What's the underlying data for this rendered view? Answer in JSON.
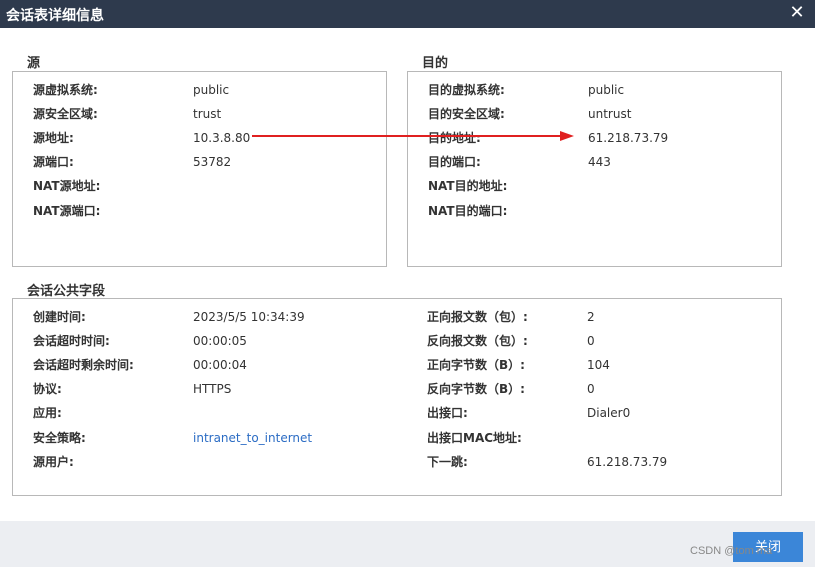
{
  "window": {
    "title": "会话表详细信息",
    "close_glyph": "✕"
  },
  "source": {
    "section_title": "源",
    "rows": [
      {
        "label": "源虚拟系统:",
        "value": "public"
      },
      {
        "label": "源安全区域:",
        "value": "trust"
      },
      {
        "label": "源地址:",
        "value": "10.3.8.80"
      },
      {
        "label": "源端口:",
        "value": "53782"
      },
      {
        "label": "NAT源地址:",
        "value": ""
      },
      {
        "label": "NAT源端口:",
        "value": ""
      }
    ]
  },
  "destination": {
    "section_title": "目的",
    "rows": [
      {
        "label": "目的虚拟系统:",
        "value": "public"
      },
      {
        "label": "目的安全区域:",
        "value": "untrust"
      },
      {
        "label": "目的地址:",
        "value": "61.218.73.79"
      },
      {
        "label": "目的端口:",
        "value": "443"
      },
      {
        "label": "NAT目的地址:",
        "value": ""
      },
      {
        "label": "NAT目的端口:",
        "value": ""
      }
    ]
  },
  "common": {
    "section_title": "会话公共字段",
    "left_rows": [
      {
        "label": "创建时间:",
        "value": "2023/5/5 10:34:39"
      },
      {
        "label": "会话超时时间:",
        "value": "00:00:05"
      },
      {
        "label": "会话超时剩余时间:",
        "value": "00:00:04"
      },
      {
        "label": "协议:",
        "value": "HTTPS"
      },
      {
        "label": "应用:",
        "value": ""
      },
      {
        "label": "安全策略:",
        "value": "intranet_to_internet"
      },
      {
        "label": "源用户:",
        "value": ""
      }
    ],
    "right_rows": [
      {
        "label": "正向报文数（包）:",
        "value": "2"
      },
      {
        "label": "反向报文数（包）:",
        "value": "0"
      },
      {
        "label": "正向字节数（B）:",
        "value": "104"
      },
      {
        "label": "反向字节数（B）:",
        "value": "0"
      },
      {
        "label": "出接口:",
        "value": "Dialer0"
      },
      {
        "label": "出接口MAC地址:",
        "value": ""
      },
      {
        "label": "下一跳:",
        "value": "61.218.73.79"
      }
    ]
  },
  "footer": {
    "close_button": "关闭",
    "watermark": "CSDN @tom ma"
  },
  "colors": {
    "titlebar": "#2e3a4d",
    "accent": "#3b86d8",
    "arrow": "#e02020",
    "link": "#2b6cc4"
  }
}
